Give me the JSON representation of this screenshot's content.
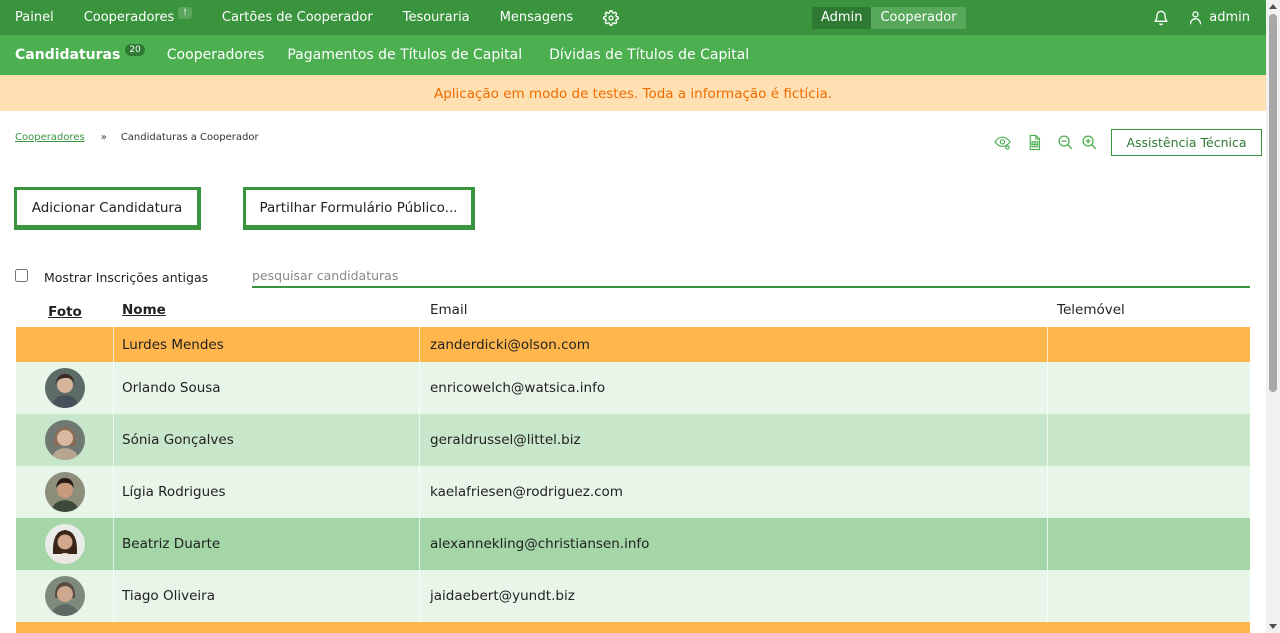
{
  "topnav": {
    "items": [
      {
        "label": "Painel"
      },
      {
        "label": "Cooperadores",
        "badge": "!"
      },
      {
        "label": "Cartões de Cooperador"
      },
      {
        "label": "Tesouraria"
      },
      {
        "label": "Mensagens"
      }
    ],
    "settings_icon": "gear-icon",
    "mode_switch": {
      "admin": "Admin",
      "cooperator": "Cooperador",
      "active": "admin"
    },
    "notifications_icon": "bell-icon",
    "user": {
      "icon": "user-icon",
      "name": "admin"
    },
    "colors": {
      "background": "#3a943e",
      "active_mode": "#2f7a32"
    }
  },
  "subnav": {
    "items": [
      {
        "label": "Candidaturas",
        "count": "20",
        "active": true
      },
      {
        "label": "Cooperadores"
      },
      {
        "label": "Pagamentos de Títulos de Capital"
      },
      {
        "label": "Dívidas de Títulos de Capital"
      }
    ],
    "colors": {
      "background": "#4caf50"
    }
  },
  "banner": {
    "text": "Aplicação em modo de testes. Toda a informação é fictícia.",
    "background": "#ffe0b2",
    "color": "#ef6c00"
  },
  "breadcrumb": {
    "parent": "Cooperadores",
    "separator": "»",
    "current": "Candidaturas a Cooperador"
  },
  "toolbar": {
    "icons": [
      "visibility-settings-icon",
      "spreadsheet-icon",
      "zoom-out-icon",
      "zoom-in-icon"
    ],
    "support_label": "Assistência Técnica"
  },
  "actions": {
    "add_label": "Adicionar Candidatura",
    "share_label": "Partilhar Formulário Público..."
  },
  "filters": {
    "show_old_label": "Mostrar Inscrições antigas",
    "show_old_checked": false,
    "search_placeholder": "pesquisar candidaturas",
    "search_value": ""
  },
  "table": {
    "columns": {
      "photo": "Foto",
      "name": "Nome",
      "email": "Email",
      "phone": "Telemóvel"
    },
    "rows": [
      {
        "photo": "",
        "name": "Lurdes Mendes",
        "email": "zanderdicki@olson.com",
        "phone": "",
        "color": "#ffb74d"
      },
      {
        "photo": "avatar-photo",
        "name": "Orlando Sousa",
        "email": "enricowelch@watsica.info",
        "phone": "",
        "color": "#e8f5e9"
      },
      {
        "photo": "avatar-photo",
        "name": "Sónia Gonçalves",
        "email": "geraldrussel@littel.biz",
        "phone": "",
        "color": "#c8e6c9"
      },
      {
        "photo": "avatar-photo",
        "name": "Lígia Rodrigues",
        "email": "kaelafriesen@rodriguez.com",
        "phone": "",
        "color": "#e8f5e9"
      },
      {
        "photo": "avatar-photo",
        "name": "Beatriz Duarte",
        "email": "alexannekling@christiansen.info",
        "phone": "",
        "color": "#a5d6a7"
      },
      {
        "photo": "avatar-photo",
        "name": "Tiago Oliveira",
        "email": "jaidaebert@yundt.biz",
        "phone": "",
        "color": "#e8f5e9"
      }
    ]
  }
}
